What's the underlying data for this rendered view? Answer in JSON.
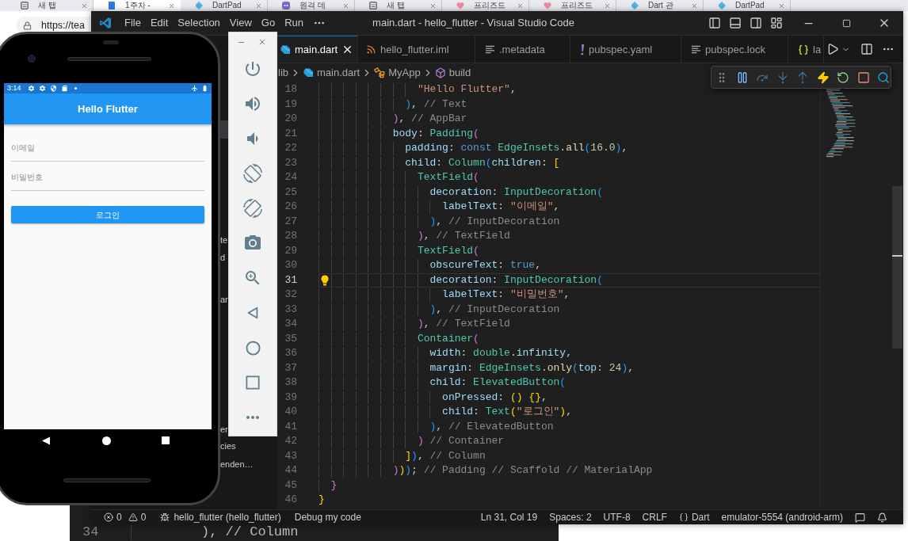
{
  "browser": {
    "tabs": [
      {
        "label": "새 탭",
        "kind": "newtab",
        "selected": false
      },
      {
        "label": "1주차 -",
        "kind": "doc",
        "selected": true
      },
      {
        "label": "DartPad",
        "kind": "dart",
        "selected": false
      },
      {
        "label": "원격 데",
        "kind": "chat",
        "selected": false
      },
      {
        "label": "새 탭",
        "kind": "newtab",
        "selected": false
      },
      {
        "label": "프리즈드",
        "kind": "heart",
        "selected": false
      },
      {
        "label": "프리즈드",
        "kind": "heart",
        "selected": false
      },
      {
        "label": "Dart 관",
        "kind": "dart",
        "selected": false
      },
      {
        "label": "DartPad",
        "kind": "dart",
        "selected": false
      }
    ],
    "address": "https://tea"
  },
  "background_editor": {
    "line_number": "34",
    "code": "), // Column"
  },
  "vscode": {
    "title": "main.dart - hello_flutter - Visual Studio Code",
    "menu": [
      "File",
      "Edit",
      "Selection",
      "View",
      "Go",
      "Run"
    ],
    "explorer_items": [
      {
        "label": "te"
      },
      {
        "label": "d"
      },
      {
        "label": "ar"
      },
      {
        "label": "er"
      },
      {
        "label": "cies"
      },
      {
        "label": "enden…"
      }
    ],
    "tabs": [
      {
        "label": "main.dart",
        "kind": "dart",
        "selected": true
      },
      {
        "label": "hello_flutter.iml",
        "kind": "feed",
        "selected": false
      },
      {
        "label": ".metadata",
        "kind": "text",
        "selected": false
      },
      {
        "label": "pubspec.yaml",
        "kind": "yaml",
        "selected": false
      },
      {
        "label": "pubspec.lock",
        "kind": "text",
        "selected": false
      },
      {
        "label": "la",
        "kind": "json",
        "selected": false
      }
    ],
    "breadcrumb": [
      {
        "label": "lib",
        "kind": "folder"
      },
      {
        "label": "main.dart",
        "kind": "dart"
      },
      {
        "label": "MyApp",
        "kind": "class"
      },
      {
        "label": "build",
        "kind": "method"
      }
    ],
    "code_lines": [
      {
        "number": "18",
        "current": false,
        "lightbulb": false,
        "tokens": [
          {
            "kind": "str",
            "text": "                \"Hello Flutter\""
          },
          {
            "kind": "p",
            "text": ","
          }
        ]
      },
      {
        "number": "19",
        "current": false,
        "lightbulb": false,
        "tokens": [
          {
            "kind": "b3",
            "text": "              )"
          },
          {
            "kind": "p",
            "text": ","
          },
          {
            "kind": "cmt",
            "text": " // Text"
          }
        ]
      },
      {
        "number": "20",
        "current": false,
        "lightbulb": false,
        "tokens": [
          {
            "kind": "b2",
            "text": "            )"
          },
          {
            "kind": "p",
            "text": ","
          },
          {
            "kind": "cmt",
            "text": " // AppBar"
          }
        ]
      },
      {
        "number": "21",
        "current": false,
        "lightbulb": false,
        "tokens": [
          {
            "kind": "prop",
            "text": "            body"
          },
          {
            "kind": "p",
            "text": ": "
          },
          {
            "kind": "cls",
            "text": "Padding"
          },
          {
            "kind": "b2",
            "text": "("
          }
        ]
      },
      {
        "number": "22",
        "current": false,
        "lightbulb": false,
        "tokens": [
          {
            "kind": "prop",
            "text": "              padding"
          },
          {
            "kind": "p",
            "text": ": "
          },
          {
            "kind": "kw",
            "text": "const"
          },
          {
            "kind": "cls",
            "text": " EdgeInsets"
          },
          {
            "kind": "p",
            "text": "."
          },
          {
            "kind": "fn",
            "text": "all"
          },
          {
            "kind": "b3",
            "text": "("
          },
          {
            "kind": "num",
            "text": "16.0"
          },
          {
            "kind": "b3",
            "text": ")"
          },
          {
            "kind": "p",
            "text": ","
          }
        ]
      },
      {
        "number": "23",
        "current": false,
        "lightbulb": false,
        "tokens": [
          {
            "kind": "prop",
            "text": "              child"
          },
          {
            "kind": "p",
            "text": ": "
          },
          {
            "kind": "cls",
            "text": "Column"
          },
          {
            "kind": "b3",
            "text": "("
          },
          {
            "kind": "prop",
            "text": "children"
          },
          {
            "kind": "p",
            "text": ": "
          },
          {
            "kind": "b1",
            "text": "["
          }
        ]
      },
      {
        "number": "24",
        "current": false,
        "lightbulb": false,
        "tokens": [
          {
            "kind": "cls",
            "text": "                TextField"
          },
          {
            "kind": "b2",
            "text": "("
          }
        ]
      },
      {
        "number": "25",
        "current": false,
        "lightbulb": false,
        "tokens": [
          {
            "kind": "prop",
            "text": "                  decoration"
          },
          {
            "kind": "p",
            "text": ": "
          },
          {
            "kind": "cls",
            "text": "InputDecoration"
          },
          {
            "kind": "b3",
            "text": "("
          }
        ]
      },
      {
        "number": "26",
        "current": false,
        "lightbulb": false,
        "tokens": [
          {
            "kind": "prop",
            "text": "                    labelText"
          },
          {
            "kind": "p",
            "text": ": "
          },
          {
            "kind": "str",
            "text": "\"이메일\""
          },
          {
            "kind": "p",
            "text": ","
          }
        ]
      },
      {
        "number": "27",
        "current": false,
        "lightbulb": false,
        "tokens": [
          {
            "kind": "b3",
            "text": "                  )"
          },
          {
            "kind": "p",
            "text": ","
          },
          {
            "kind": "cmt",
            "text": " // InputDecoration"
          }
        ]
      },
      {
        "number": "28",
        "current": false,
        "lightbulb": false,
        "tokens": [
          {
            "kind": "b2",
            "text": "                )"
          },
          {
            "kind": "p",
            "text": ","
          },
          {
            "kind": "cmt",
            "text": " // TextField"
          }
        ]
      },
      {
        "number": "29",
        "current": false,
        "lightbulb": false,
        "tokens": [
          {
            "kind": "cls",
            "text": "                TextField"
          },
          {
            "kind": "b2",
            "text": "("
          }
        ]
      },
      {
        "number": "30",
        "current": false,
        "lightbulb": false,
        "tokens": [
          {
            "kind": "prop",
            "text": "                  obscureText"
          },
          {
            "kind": "p",
            "text": ": "
          },
          {
            "kind": "kw",
            "text": "true"
          },
          {
            "kind": "p",
            "text": ","
          }
        ]
      },
      {
        "number": "31",
        "current": true,
        "lightbulb": true,
        "tokens": [
          {
            "kind": "prop",
            "text": "                  decoration"
          },
          {
            "kind": "p",
            "text": ": "
          },
          {
            "kind": "cls",
            "text": "InputDecoration"
          },
          {
            "kind": "b3",
            "text": "("
          }
        ]
      },
      {
        "number": "32",
        "current": false,
        "lightbulb": false,
        "tokens": [
          {
            "kind": "prop",
            "text": "                    labelText"
          },
          {
            "kind": "p",
            "text": ": "
          },
          {
            "kind": "str",
            "text": "\"비밀번호\""
          },
          {
            "kind": "p",
            "text": ","
          }
        ]
      },
      {
        "number": "33",
        "current": false,
        "lightbulb": false,
        "tokens": [
          {
            "kind": "b3",
            "text": "                  )"
          },
          {
            "kind": "p",
            "text": ","
          },
          {
            "kind": "cmt",
            "text": " // InputDecoration"
          }
        ]
      },
      {
        "number": "34",
        "current": false,
        "lightbulb": false,
        "tokens": [
          {
            "kind": "b2",
            "text": "                )"
          },
          {
            "kind": "p",
            "text": ","
          },
          {
            "kind": "cmt",
            "text": " // TextField"
          }
        ]
      },
      {
        "number": "35",
        "current": false,
        "lightbulb": false,
        "tokens": [
          {
            "kind": "cls",
            "text": "                Container"
          },
          {
            "kind": "b2",
            "text": "("
          }
        ]
      },
      {
        "number": "36",
        "current": false,
        "lightbulb": false,
        "tokens": [
          {
            "kind": "prop",
            "text": "                  width"
          },
          {
            "kind": "p",
            "text": ": "
          },
          {
            "kind": "cls",
            "text": "double"
          },
          {
            "kind": "p",
            "text": "."
          },
          {
            "kind": "prop",
            "text": "infinity"
          },
          {
            "kind": "p",
            "text": ","
          }
        ]
      },
      {
        "number": "37",
        "current": false,
        "lightbulb": false,
        "tokens": [
          {
            "kind": "prop",
            "text": "                  margin"
          },
          {
            "kind": "p",
            "text": ": "
          },
          {
            "kind": "cls",
            "text": "EdgeInsets"
          },
          {
            "kind": "p",
            "text": "."
          },
          {
            "kind": "fn",
            "text": "only"
          },
          {
            "kind": "b3",
            "text": "("
          },
          {
            "kind": "prop",
            "text": "top"
          },
          {
            "kind": "p",
            "text": ": "
          },
          {
            "kind": "num",
            "text": "24"
          },
          {
            "kind": "b3",
            "text": ")"
          },
          {
            "kind": "p",
            "text": ","
          }
        ]
      },
      {
        "number": "38",
        "current": false,
        "lightbulb": false,
        "tokens": [
          {
            "kind": "prop",
            "text": "                  child"
          },
          {
            "kind": "p",
            "text": ": "
          },
          {
            "kind": "cls",
            "text": "ElevatedButton"
          },
          {
            "kind": "b3",
            "text": "("
          }
        ]
      },
      {
        "number": "39",
        "current": false,
        "lightbulb": false,
        "tokens": [
          {
            "kind": "prop",
            "text": "                    onPressed"
          },
          {
            "kind": "p",
            "text": ": "
          },
          {
            "kind": "b1",
            "text": "() {}"
          },
          {
            "kind": "p",
            "text": ","
          }
        ]
      },
      {
        "number": "40",
        "current": false,
        "lightbulb": false,
        "tokens": [
          {
            "kind": "prop",
            "text": "                    child"
          },
          {
            "kind": "p",
            "text": ": "
          },
          {
            "kind": "cls",
            "text": "Text"
          },
          {
            "kind": "b1",
            "text": "("
          },
          {
            "kind": "str",
            "text": "\"로그인\""
          },
          {
            "kind": "b1",
            "text": ")"
          },
          {
            "kind": "p",
            "text": ","
          }
        ]
      },
      {
        "number": "41",
        "current": false,
        "lightbulb": false,
        "tokens": [
          {
            "kind": "b3",
            "text": "                  )"
          },
          {
            "kind": "p",
            "text": ","
          },
          {
            "kind": "cmt",
            "text": " // ElevatedButton"
          }
        ]
      },
      {
        "number": "42",
        "current": false,
        "lightbulb": false,
        "tokens": [
          {
            "kind": "b2",
            "text": "                )"
          },
          {
            "kind": "cmt",
            "text": " // Container"
          }
        ]
      },
      {
        "number": "43",
        "current": false,
        "lightbulb": false,
        "tokens": [
          {
            "kind": "b1",
            "text": "              ]"
          },
          {
            "kind": "b3",
            "text": ")"
          },
          {
            "kind": "p",
            "text": ","
          },
          {
            "kind": "cmt",
            "text": " // Column"
          }
        ]
      },
      {
        "number": "44",
        "current": false,
        "lightbulb": false,
        "tokens": [
          {
            "kind": "b2",
            "text": "            )"
          },
          {
            "kind": "b1",
            "text": ")"
          },
          {
            "kind": "b3",
            "text": ")"
          },
          {
            "kind": "p",
            "text": ";"
          },
          {
            "kind": "cmt",
            "text": " // Padding // Scaffold // MaterialApp"
          }
        ]
      },
      {
        "number": "45",
        "current": false,
        "lightbulb": false,
        "tokens": [
          {
            "kind": "b2",
            "text": "  }"
          }
        ]
      },
      {
        "number": "46",
        "current": false,
        "lightbulb": false,
        "tokens": [
          {
            "kind": "b1",
            "text": "}"
          }
        ]
      }
    ],
    "status_bar": {
      "errors": "0",
      "warnings": "0",
      "launch_config": "hello_flutter (hello_flutter)",
      "debug_mode": "Debug my code",
      "cursor": "Ln 31, Col 19",
      "indent": "Spaces: 2",
      "encoding": "UTF-8",
      "eol": "CRLF",
      "language": "Dart",
      "device": "emulator-5554 (android-arm)"
    }
  },
  "phone": {
    "status_time": "3:14",
    "app_title": "Hello Flutter",
    "fields": [
      {
        "placeholder": "이메일"
      },
      {
        "placeholder": "비밀번호"
      }
    ],
    "button": "로그인"
  }
}
